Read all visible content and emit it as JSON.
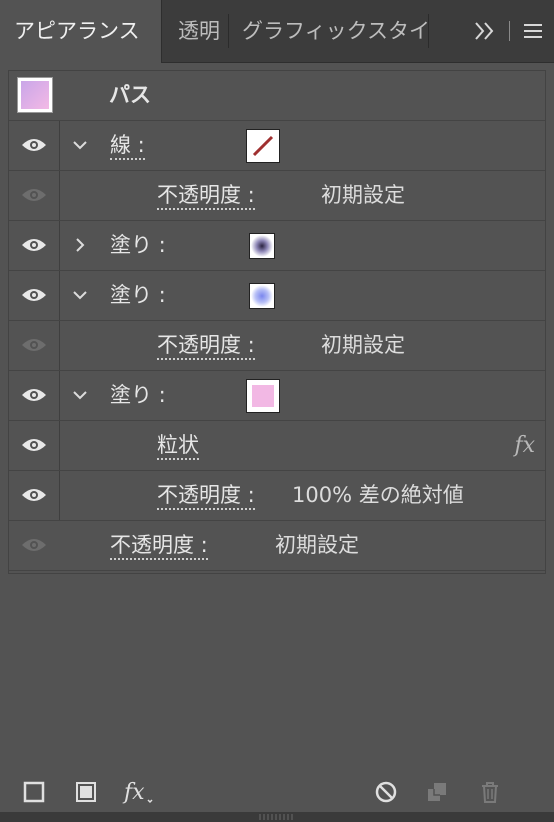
{
  "tabs": [
    {
      "label": "アピアランス",
      "active": true
    },
    {
      "label": "透明",
      "active": false
    },
    {
      "label": "グラフィックスタイ",
      "active": false
    }
  ],
  "tabbar_icons": {
    "overflow": "chevron-double-right-icon",
    "menu": "hamburger-menu-icon"
  },
  "header": {
    "title": "パス",
    "thumbnail": "path-thumbnail"
  },
  "rows": [
    {
      "label": "線 :",
      "kind": "stroke",
      "expanded": true,
      "visible": true,
      "swatch": "stroke-none-swatch",
      "selected_swatch": true
    },
    {
      "label": "不透明度 :",
      "value": "初期設定",
      "visible": false
    },
    {
      "label": "塗り :",
      "kind": "fill",
      "expanded": false,
      "visible": true,
      "swatch": "fill-dark-swatch"
    },
    {
      "label": "塗り :",
      "kind": "fill",
      "expanded": true,
      "visible": true,
      "swatch": "fill-blue-swatch"
    },
    {
      "label": "不透明度 :",
      "value": "初期設定",
      "visible": false
    },
    {
      "label": "塗り :",
      "kind": "fill",
      "expanded": true,
      "visible": true,
      "swatch": "fill-pink-swatch",
      "selected_swatch": true
    },
    {
      "label": "粒状",
      "fx": "fx",
      "visible": true
    },
    {
      "label": "不透明度 :",
      "value": "100% 差の絶対値",
      "visible": true
    },
    {
      "label": "不透明度 :",
      "value": "初期設定",
      "visible": false
    }
  ],
  "bottom_toolbar": [
    "add-stroke-icon",
    "add-fill-icon",
    "fx-icon",
    "clear-appearance-icon",
    "duplicate-item-icon",
    "trash-icon"
  ],
  "colors": {
    "panel_bg": "#535353",
    "tabbar_bg": "#3c3c3c",
    "eye_on": "#e8e8e8",
    "eye_off": "#6d6d6d"
  }
}
